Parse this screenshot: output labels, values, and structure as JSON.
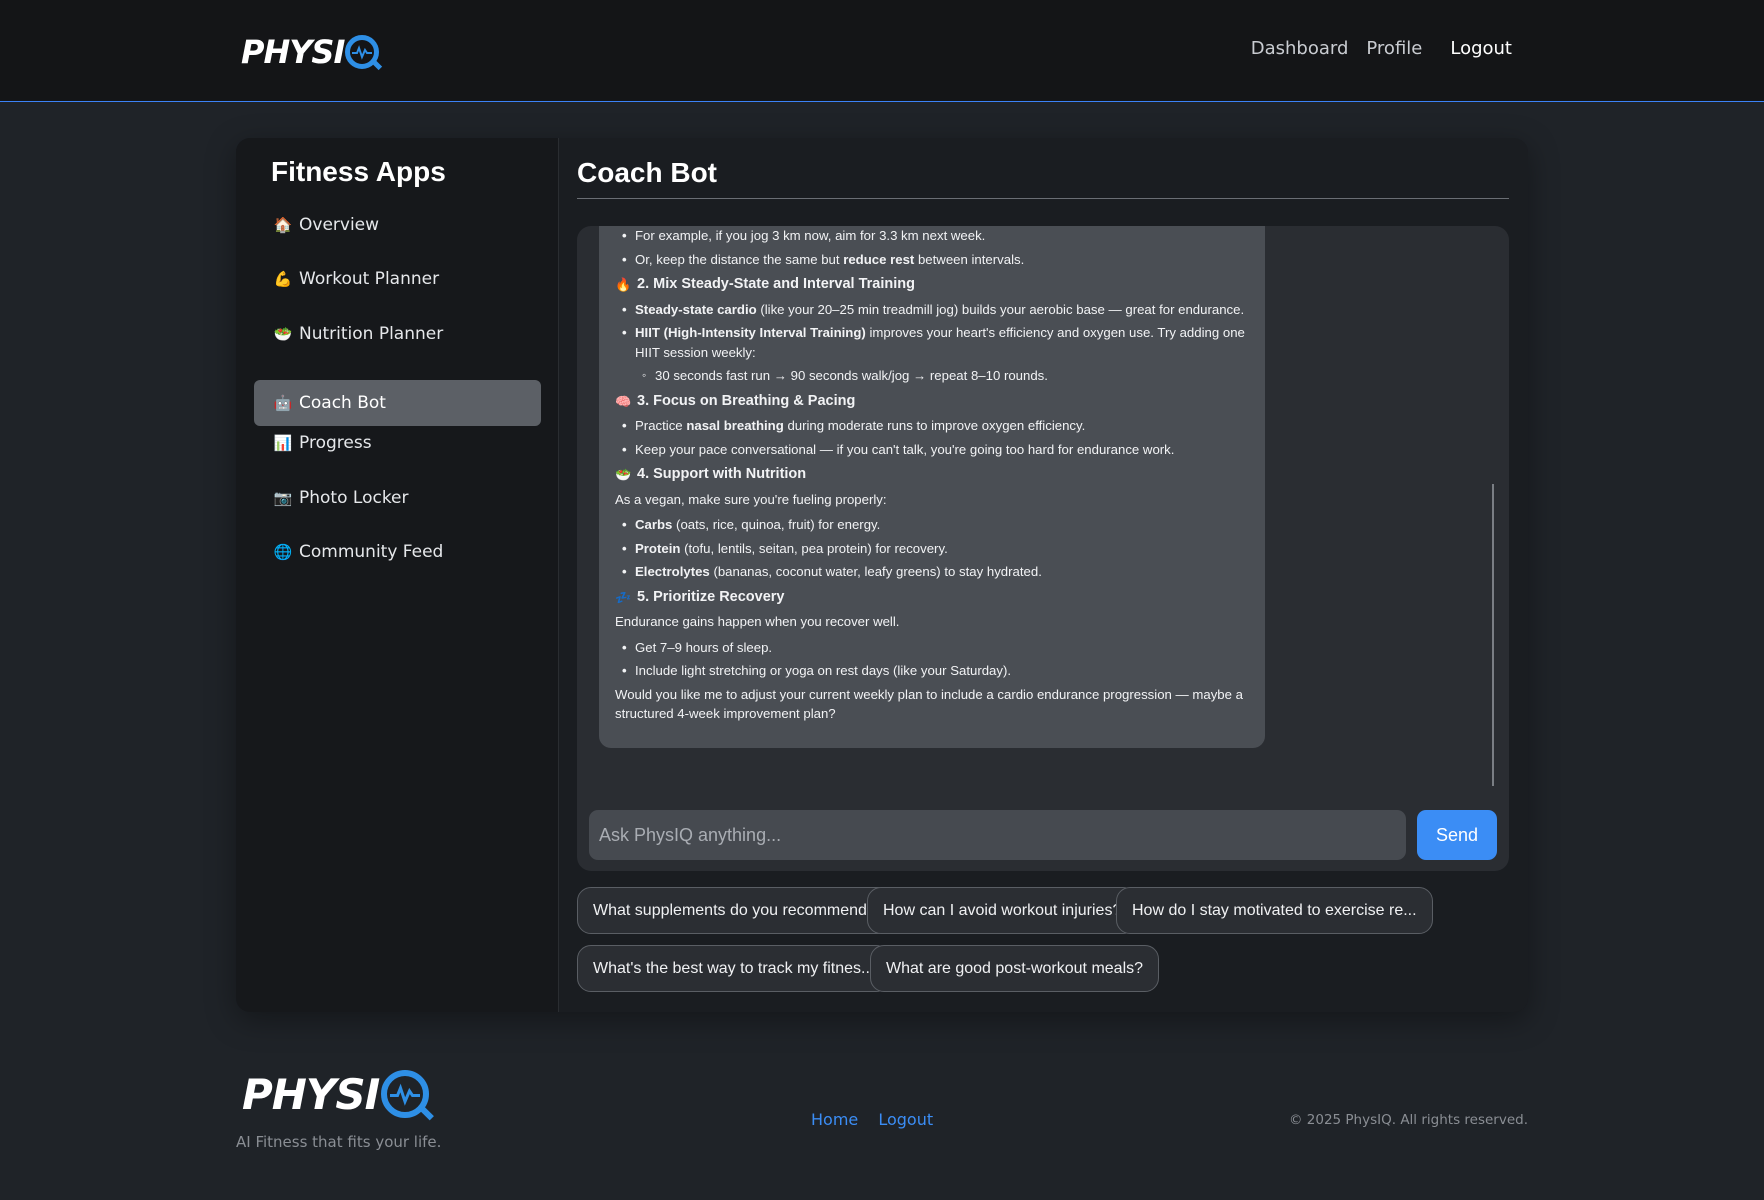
{
  "brand": {
    "logo_text": "PHYSI",
    "tagline": "AI Fitness that fits your life."
  },
  "nav": {
    "dashboard": "Dashboard",
    "profile": "Profile",
    "logout": "Logout"
  },
  "sidebar": {
    "title": "Fitness Apps",
    "items": [
      {
        "icon": "🏠",
        "label": "Overview"
      },
      {
        "icon": "💪",
        "label": "Workout Planner"
      },
      {
        "icon": "🥗",
        "label": "Nutrition Planner"
      },
      {
        "icon": "🤖",
        "label": "Coach Bot",
        "active": true
      },
      {
        "icon": "📊",
        "label": "Progress"
      },
      {
        "icon": "📷",
        "label": "Photo Locker"
      },
      {
        "icon": "🌐",
        "label": "Community Feed"
      }
    ]
  },
  "main": {
    "title": "Coach Bot",
    "message": {
      "cut_line": "For example, if you jog 3 km now, aim for 3.3 km next week.",
      "b1": {
        "pre": "Or, keep the distance the same but ",
        "bold": "reduce rest",
        "post": " between intervals."
      },
      "h2": {
        "icon": "🔥",
        "text": "2. Mix Steady-State and Interval Training"
      },
      "b2": {
        "bold": "Steady-state cardio",
        "post": " (like your 20–25 min treadmill jog) builds your aerobic base — great for endurance."
      },
      "b3": {
        "bold": "HIIT (High-Intensity Interval Training)",
        "post": " improves your heart's efficiency and oxygen use. Try adding one HIIT session weekly:"
      },
      "b3_sub": "30 seconds fast run → 90 seconds walk/jog → repeat 8–10 rounds.",
      "h3": {
        "icon": "🧠",
        "text": "3. Focus on Breathing & Pacing"
      },
      "b4": {
        "pre": "Practice ",
        "bold": "nasal breathing",
        "post": " during moderate runs to improve oxygen efficiency."
      },
      "b5": "Keep your pace conversational — if you can't talk, you're going too hard for endurance work.",
      "h4": {
        "icon": "🥗",
        "text": "4. Support with Nutrition"
      },
      "p4": "As a vegan, make sure you're fueling properly:",
      "b6": {
        "bold": "Carbs",
        "post": " (oats, rice, quinoa, fruit) for energy."
      },
      "b7": {
        "bold": "Protein",
        "post": " (tofu, lentils, seitan, pea protein) for recovery."
      },
      "b8": {
        "bold": "Electrolytes",
        "post": " (bananas, coconut water, leafy greens) to stay hydrated."
      },
      "h5": {
        "icon": "💤",
        "text": "5. Prioritize Recovery"
      },
      "p5": "Endurance gains happen when you recover well.",
      "b9": "Get 7–9 hours of sleep.",
      "b10": "Include light stretching or yoga on rest days (like your Saturday).",
      "closing": "Would you like me to adjust your current weekly plan to include a cardio endurance progression — maybe a structured 4-week improvement plan?"
    },
    "input": {
      "placeholder": "Ask PhysIQ anything...",
      "value": ""
    },
    "send_label": "Send",
    "suggestions": [
      "What supplements do you recommend?",
      "How can I avoid workout injuries?",
      "How do I stay motivated to exercise re...",
      "What's the best way to track my fitnes...",
      "What are good post-workout meals?"
    ]
  },
  "footer": {
    "links": {
      "home": "Home",
      "logout": "Logout"
    },
    "copyright": "© 2025 PhysIQ. All rights reserved."
  },
  "colors": {
    "accent": "#3b8df5",
    "logo_q": "#2e8fe6",
    "background": "#1f2328"
  }
}
